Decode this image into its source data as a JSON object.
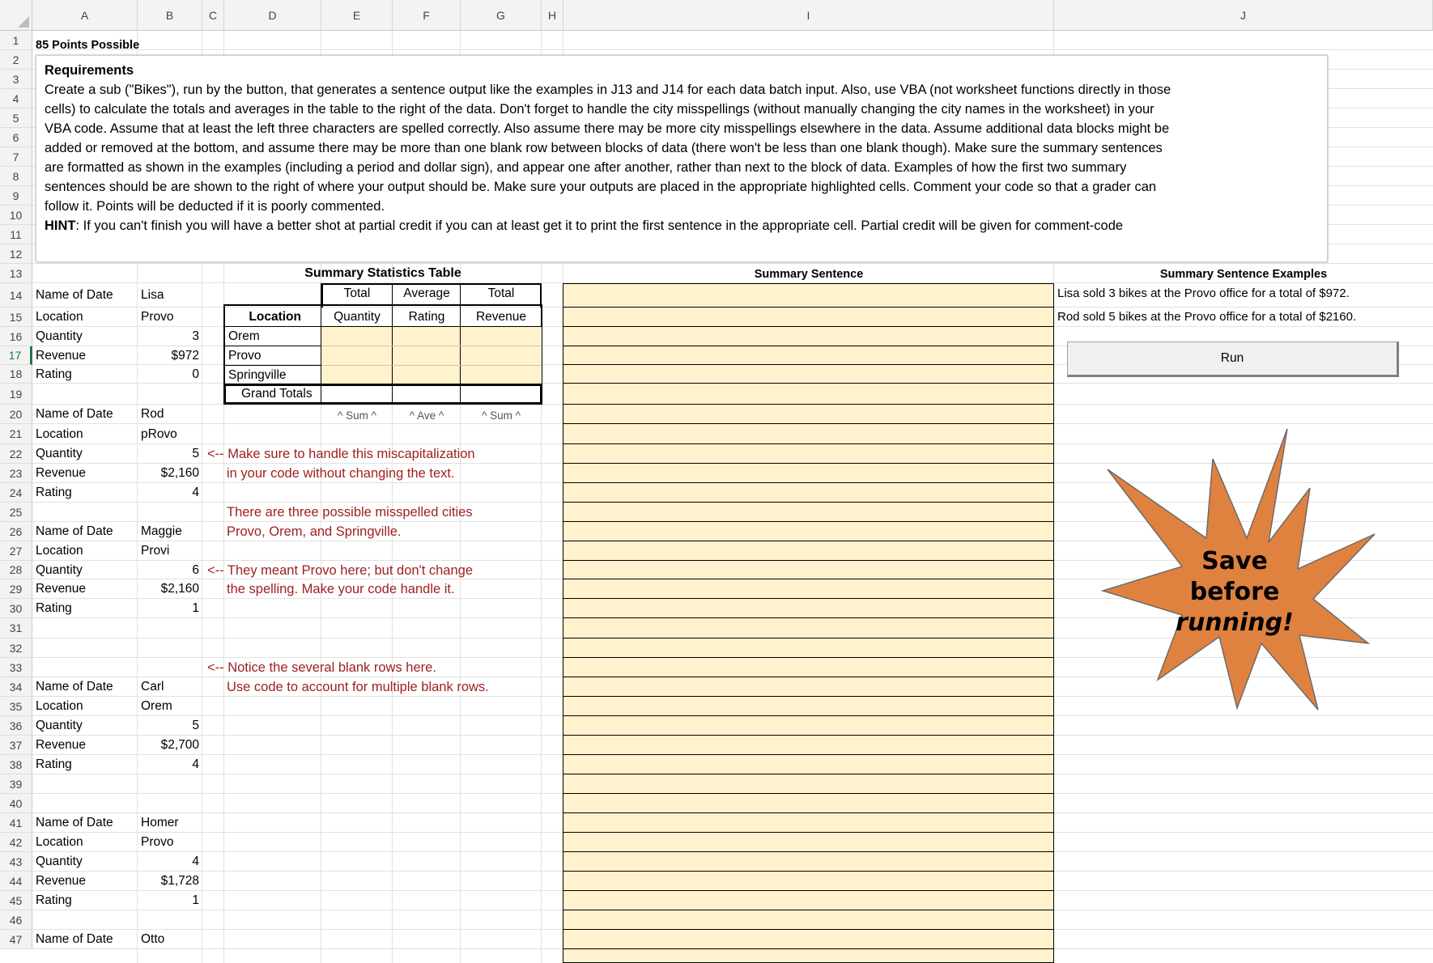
{
  "columns": [
    "A",
    "B",
    "C",
    "D",
    "E",
    "F",
    "G",
    "H",
    "I",
    "J"
  ],
  "rows": [
    "1",
    "2",
    "3",
    "4",
    "5",
    "6",
    "7",
    "8",
    "9",
    "10",
    "11",
    "12",
    "13",
    "14",
    "15",
    "16",
    "17",
    "18",
    "19",
    "20",
    "21",
    "22",
    "23",
    "24",
    "25",
    "26",
    "27",
    "28",
    "29",
    "30",
    "31",
    "32",
    "33",
    "34",
    "35",
    "36",
    "37",
    "38",
    "39",
    "40",
    "41",
    "42",
    "43",
    "44",
    "45",
    "46",
    "47"
  ],
  "a1": "85 Points Possible",
  "requirements": {
    "title": "Requirements",
    "lines": [
      "Create a sub (\"Bikes\"), run by the button, that generates a sentence output like the examples in J13 and J14 for each data batch input. Also, use VBA (not worksheet functions directly in those",
      "cells) to calculate the totals and averages in the table to the right of the data. Don't forget to handle the city misspellings (without manually changing the city names in the worksheet) in your",
      "VBA code. Assume that at least the left three characters are spelled correctly. Also assume there may be more city misspellings elsewhere in the data. Assume additional data blocks might be",
      "added or removed at the bottom, and assume there may be more than one blank row between blocks of data (there won't be less than one blank though). Make sure the summary sentences",
      "are formatted as shown in the examples (including a period and dollar sign), and appear one after another, rather than next to the block of data. Examples of how the first two summary",
      "sentences should be are shown to the right of where your output should be. Make sure your outputs are placed in the appropriate highlighted cells. Comment your code so that a grader can",
      "follow it. Points will be deducted if it is poorly commented."
    ],
    "hint_label": "HINT",
    "hint_text": ": If you can't finish you will have a better shot at partial credit if you can at least get it to print the first sentence in the appropriate cell. Partial credit will be given for comment-code"
  },
  "labels": {
    "name": "Name of Date",
    "location": "Location",
    "quantity": "Quantity",
    "revenue": "Revenue",
    "rating": "Rating"
  },
  "blocks": [
    {
      "name": "Lisa",
      "location": "Provo",
      "quantity": "3",
      "revenue": "$972",
      "rating": "0"
    },
    {
      "name": "Rod",
      "location": "pRovo",
      "quantity": "5",
      "revenue": "$2,160",
      "rating": "4"
    },
    {
      "name": "Maggie",
      "location": "Provi",
      "quantity": "6",
      "revenue": "$2,160",
      "rating": "1"
    },
    {
      "name": "Carl",
      "location": "Orem",
      "quantity": "5",
      "revenue": "$2,700",
      "rating": "4"
    },
    {
      "name": "Homer",
      "location": "Provo",
      "quantity": "4",
      "revenue": "$1,728",
      "rating": "1"
    },
    {
      "name": "Otto"
    }
  ],
  "summary_table": {
    "title": "Summary Statistics Table",
    "header_top": [
      "Total",
      "Average",
      "Total"
    ],
    "header_bottom": [
      "Location",
      "Quantity",
      "Rating",
      "Revenue"
    ],
    "locations": [
      "Orem",
      "Provo",
      "Springville"
    ],
    "grand_totals": "Grand Totals",
    "footers": [
      "^ Sum ^",
      "^ Ave ^",
      "^ Sum ^"
    ]
  },
  "notes": [
    "<-- Make sure to handle this miscapitalization",
    "in your code without changing the text.",
    "There are three possible misspelled cities",
    "Provo, Orem, and Springville.",
    "<-- They meant Provo here; but don't change",
    "the spelling. Make your code handle it.",
    "<-- Notice the several blank rows here.",
    "Use code to account for multiple blank rows."
  ],
  "summary_sentence_header": "Summary Sentence",
  "examples": {
    "header": "Summary Sentence Examples",
    "items": [
      "Lisa sold 3 bikes at the Provo office for a total of $972.",
      "Rod sold 5 bikes at the Provo office for a total of $2160."
    ]
  },
  "run_button": "Run",
  "starburst": {
    "line1": "Save",
    "line2": "before",
    "line3": "running!",
    "color": "#e0823f"
  },
  "colors": {
    "highlight": "#fff2cc",
    "note": "#a02020",
    "selected": "#217346"
  }
}
